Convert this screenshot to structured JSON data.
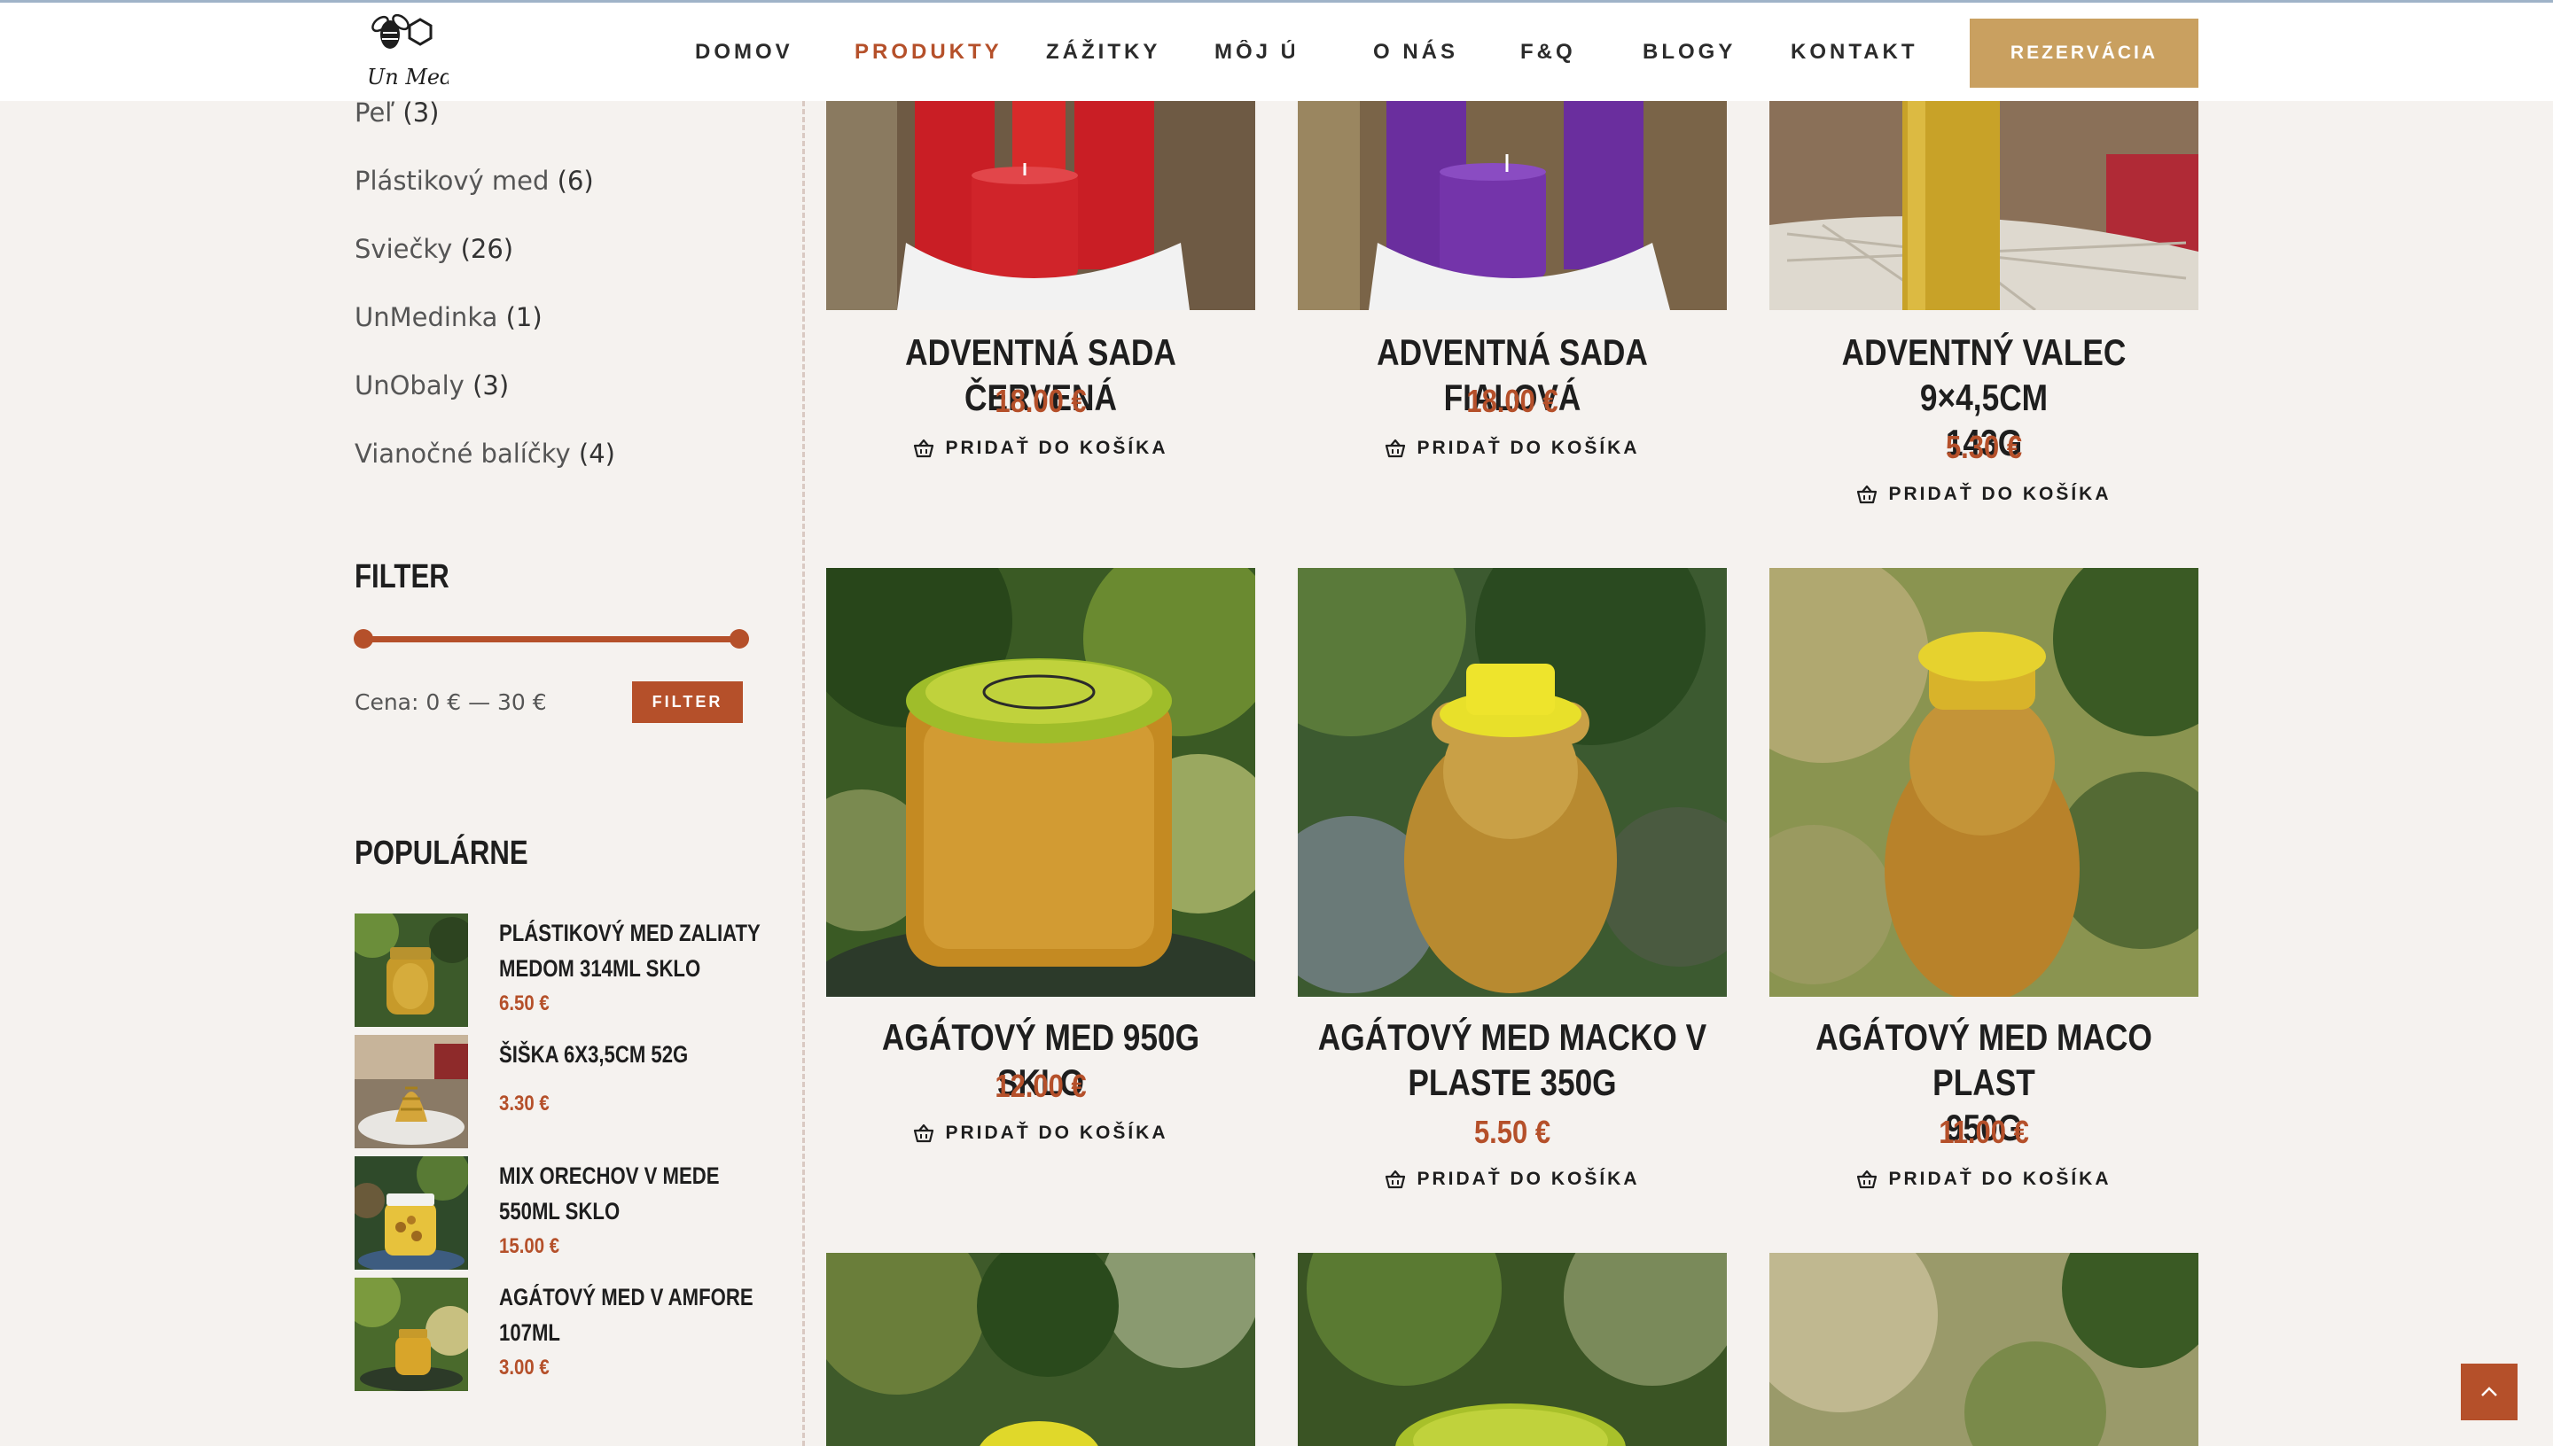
{
  "brand": {
    "logo_text": "Un Medy"
  },
  "nav": {
    "items": [
      {
        "label": "DOMOV"
      },
      {
        "label": "PRODUKTY"
      },
      {
        "label": "ZÁŽITKY"
      },
      {
        "label": "MÔJ ÚĽ"
      },
      {
        "label": "O NÁS"
      },
      {
        "label": "F&Q"
      },
      {
        "label": "BLOGY"
      },
      {
        "label": "KONTAKT"
      }
    ],
    "active": "PRODUKTY",
    "cta_label": "REZERVÁCIA"
  },
  "categories": [
    {
      "name": "Peľ",
      "count": "(3)"
    },
    {
      "name": "Plástikový med",
      "count": "(6)"
    },
    {
      "name": "Sviečky",
      "count": "(26)"
    },
    {
      "name": "UnMedinka",
      "count": "(1)"
    },
    {
      "name": "UnObaly",
      "count": "(3)"
    },
    {
      "name": "Vianočné balíčky",
      "count": "(4)"
    }
  ],
  "filter": {
    "title": "FILTER",
    "range_text": "Cena: 0 € — 30 €",
    "button_label": "FILTER",
    "min_fraction": 0,
    "max_fraction": 1
  },
  "popular": {
    "title": "POPULÁRNE",
    "items": [
      {
        "title_line1": "PLÁSTIKOVÝ MED ZALIATY",
        "title_line2": "MEDOM 314ML SKLO",
        "price": "6.50 €"
      },
      {
        "title_line1": "ŠIŠKA 6X3,5CM 52G",
        "title_line2": "",
        "price": "3.30 €"
      },
      {
        "title_line1": "MIX ORECHOV V MEDE",
        "title_line2": "550ML SKLO",
        "price": "15.00 €"
      },
      {
        "title_line1": "AGÁTOVÝ MED V AMFORE",
        "title_line2": "107ML",
        "price": "3.00 €"
      }
    ]
  },
  "products": [
    {
      "title_line1": "ADVENTNÁ SADA ČERVENÁ",
      "title_line2": "",
      "price": "18.00 €",
      "cta": "PRIDAŤ DO KOŠÍKA"
    },
    {
      "title_line1": "ADVENTNÁ SADA FIALOVÁ",
      "title_line2": "",
      "price": "18.00 €",
      "cta": "PRIDAŤ DO KOŠÍKA"
    },
    {
      "title_line1": "ADVENTNÝ VALEC 9×4,5CM",
      "title_line2": "143G",
      "price": "5.30 €",
      "cta": "PRIDAŤ DO KOŠÍKA"
    },
    {
      "title_line1": "AGÁTOVÝ MED 950G SKLO",
      "title_line2": "",
      "price": "12.00 €",
      "cta": "PRIDAŤ DO KOŠÍKA"
    },
    {
      "title_line1": "AGÁTOVÝ MED MACKO V",
      "title_line2": "PLASTE 350G",
      "price": "5.50 €",
      "cta": "PRIDAŤ DO KOŠÍKA"
    },
    {
      "title_line1": "AGÁTOVÝ MED MACO PLAST",
      "title_line2": "950G",
      "price": "11.00 €",
      "cta": "PRIDAŤ DO KOŠÍKA"
    }
  ],
  "colors": {
    "accent": "#b5502a",
    "cta": "#c9a060",
    "background": "#f5f2ef"
  },
  "icons": {
    "cart": "basket-icon",
    "scroll_top": "chevron-up-icon"
  }
}
